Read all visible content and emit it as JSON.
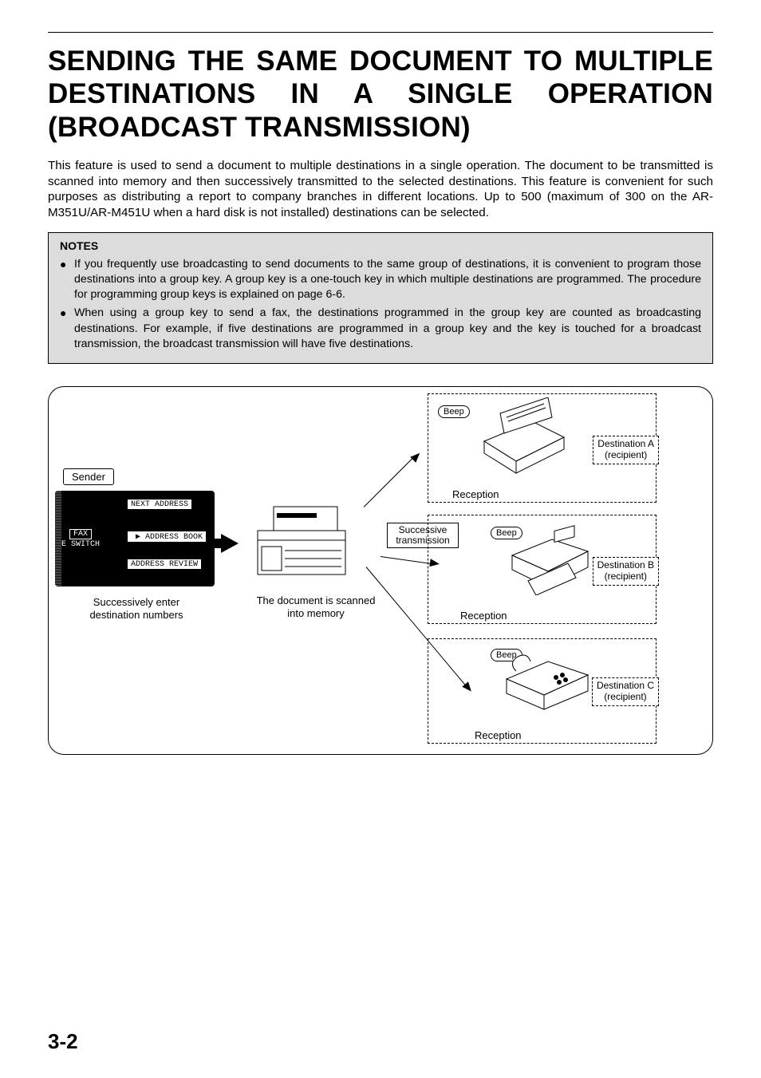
{
  "title_line1": "SENDING THE SAME DOCUMENT TO MULTIPLE",
  "title_line2": "DESTINATIONS IN A SINGLE OPERATION",
  "title_line3": "(BROADCAST TRANSMISSION)",
  "intro": "This feature is used to send a document to multiple destinations in a single operation. The document to be transmitted is scanned into memory and then successively transmitted to the selected destinations. This feature is convenient for such purposes as distributing a report to company branches in different locations. Up to 500 (maximum of 300 on the AR-M351U/AR-M451U when a hard disk is not installed) destinations can be selected.",
  "notes": {
    "heading": "NOTES",
    "items": [
      "If you frequently use broadcasting to send documents to the same group of destinations, it is convenient to program those destinations into a group key. A group key is a one-touch key in which multiple destinations are programmed. The procedure for programming group keys is explained on page 6-6.",
      "When using a group key to send a fax, the destinations programmed in the group key are counted as broadcasting destinations. For example, if five destinations are programmed in a group key and the key is touched for a broadcast transmission, the broadcast transmission will have five destinations."
    ]
  },
  "diagram": {
    "sender": "Sender",
    "panel": {
      "next_address": "NEXT ADDRESS",
      "fax": "FAX",
      "switch": "E SWITCH",
      "address_book": "ADDRESS BOOK",
      "address_review": "ADDRESS REVIEW"
    },
    "panel_caption": "Successively enter destination numbers",
    "scan_caption": "The document is scanned into memory",
    "successive": "Successive transmission",
    "beep": "Beep",
    "reception": "Reception",
    "destA": {
      "l1": "Destination A",
      "l2": "(recipient)"
    },
    "destB": {
      "l1": "Destination B",
      "l2": "(recipient)"
    },
    "destC": {
      "l1": "Destination C",
      "l2": "(recipient)"
    }
  },
  "page_number": "3-2"
}
